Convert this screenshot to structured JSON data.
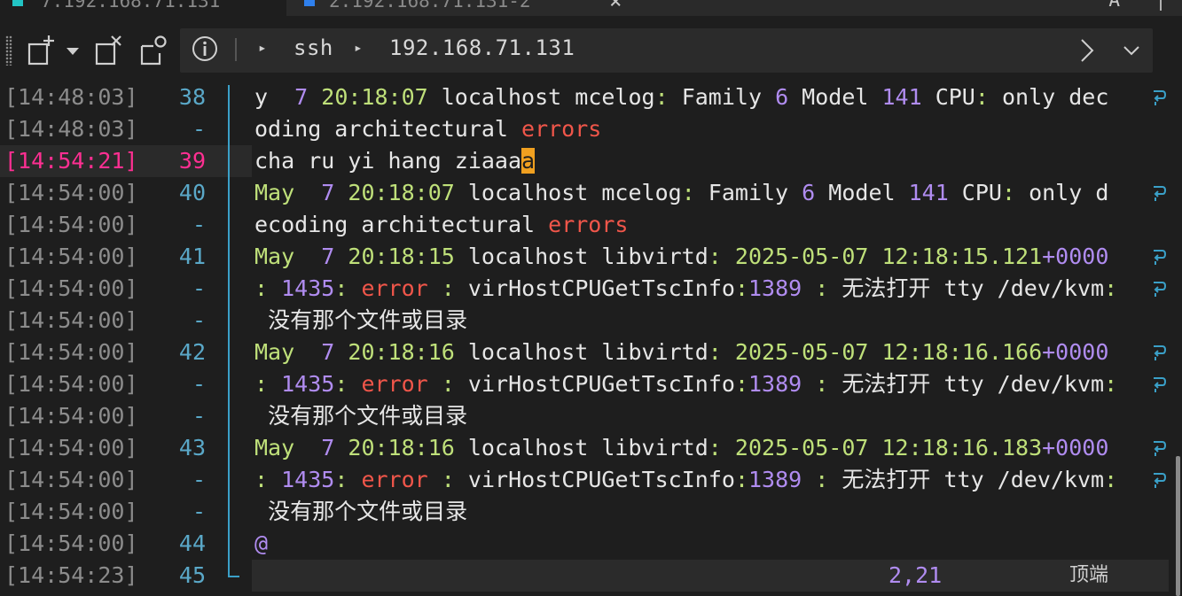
{
  "tabs": [
    {
      "label": "7.192.168.71.131",
      "active": true,
      "color": "#22c4c4"
    },
    {
      "label": "2.192.168.71.131-2",
      "active": false,
      "color": "#2f80ed"
    }
  ],
  "window_controls": {
    "a_label": "A",
    "close_label": "×"
  },
  "toolbar": {
    "icons": [
      "new-tab-icon",
      "dropdown-icon",
      "detach-tab-icon",
      "session-settings-icon"
    ]
  },
  "breadcrumb": {
    "arrow": "▸",
    "items": [
      "ssh",
      "192.168.71.131"
    ]
  },
  "gutter": [
    {
      "time": "[14:48:03]",
      "line": "38"
    },
    {
      "time": "[14:48:03]",
      "line": "-"
    },
    {
      "time": "[14:54:21]",
      "line": "39",
      "active": true
    },
    {
      "time": "[14:54:00]",
      "line": "40"
    },
    {
      "time": "[14:54:00]",
      "line": "-"
    },
    {
      "time": "[14:54:00]",
      "line": "41"
    },
    {
      "time": "[14:54:00]",
      "line": "-"
    },
    {
      "time": "[14:54:00]",
      "line": "-"
    },
    {
      "time": "[14:54:00]",
      "line": "42"
    },
    {
      "time": "[14:54:00]",
      "line": "-"
    },
    {
      "time": "[14:54:00]",
      "line": "-"
    },
    {
      "time": "[14:54:00]",
      "line": "43"
    },
    {
      "time": "[14:54:00]",
      "line": "-"
    },
    {
      "time": "[14:54:00]",
      "line": "-"
    },
    {
      "time": "[14:54:00]",
      "line": "44"
    },
    {
      "time": "[14:54:23]",
      "line": "45"
    }
  ],
  "lines": [
    {
      "wrap": true,
      "segs": [
        [
          "y  ",
          "white"
        ],
        [
          "7",
          "purple"
        ],
        [
          " ",
          "white"
        ],
        [
          "20:18:07",
          "green"
        ],
        [
          " localhost mcelog",
          "white"
        ],
        [
          ":",
          "green"
        ],
        [
          " Family ",
          "white"
        ],
        [
          "6",
          "purple"
        ],
        [
          " Model ",
          "white"
        ],
        [
          "141",
          "purple"
        ],
        [
          " CPU",
          "white"
        ],
        [
          ":",
          "green"
        ],
        [
          " only dec",
          "white"
        ]
      ]
    },
    {
      "wrap": false,
      "segs": [
        [
          "oding architectural ",
          "white"
        ],
        [
          "errors",
          "red"
        ]
      ]
    },
    {
      "wrap": false,
      "segs": [
        [
          "cha ru yi hang ziaaa",
          "white"
        ],
        [
          "a",
          "cursor"
        ]
      ]
    },
    {
      "wrap": true,
      "segs": [
        [
          "May",
          "green"
        ],
        [
          "  ",
          "white"
        ],
        [
          "7",
          "purple"
        ],
        [
          " ",
          "white"
        ],
        [
          "20:18:07",
          "green"
        ],
        [
          " localhost mcelog",
          "white"
        ],
        [
          ":",
          "green"
        ],
        [
          " Family ",
          "white"
        ],
        [
          "6",
          "purple"
        ],
        [
          " Model ",
          "white"
        ],
        [
          "141",
          "purple"
        ],
        [
          " CPU",
          "white"
        ],
        [
          ":",
          "green"
        ],
        [
          " only d",
          "white"
        ]
      ]
    },
    {
      "wrap": false,
      "segs": [
        [
          "ecoding architectural ",
          "white"
        ],
        [
          "errors",
          "red"
        ]
      ]
    },
    {
      "wrap": true,
      "segs": [
        [
          "May",
          "green"
        ],
        [
          "  ",
          "white"
        ],
        [
          "7",
          "purple"
        ],
        [
          " ",
          "white"
        ],
        [
          "20:18:15",
          "green"
        ],
        [
          " localhost libvirtd",
          "white"
        ],
        [
          ":",
          "green"
        ],
        [
          " ",
          "white"
        ],
        [
          "2025-05-07",
          "green"
        ],
        [
          " ",
          "white"
        ],
        [
          "12:18:15.121",
          "green"
        ],
        [
          "+0000",
          "purple"
        ]
      ]
    },
    {
      "wrap": true,
      "segs": [
        [
          ":",
          "green"
        ],
        [
          " ",
          "white"
        ],
        [
          "1435",
          "purple"
        ],
        [
          ":",
          "green"
        ],
        [
          " ",
          "white"
        ],
        [
          "error",
          "red"
        ],
        [
          " ",
          "white"
        ],
        [
          ":",
          "green"
        ],
        [
          " virHostCPUGetTscInfo",
          "white"
        ],
        [
          ":",
          "green"
        ],
        [
          "1389",
          "purple"
        ],
        [
          " ",
          "white"
        ],
        [
          ":",
          "green"
        ],
        [
          " ",
          "white"
        ],
        [
          "无法打开",
          "cjk"
        ],
        [
          " tty /dev/kvm",
          "white"
        ],
        [
          ":",
          "green"
        ]
      ]
    },
    {
      "wrap": false,
      "segs": [
        [
          " ",
          "white"
        ],
        [
          "没有那个文件或目录",
          "cjk"
        ]
      ]
    },
    {
      "wrap": true,
      "segs": [
        [
          "May",
          "green"
        ],
        [
          "  ",
          "white"
        ],
        [
          "7",
          "purple"
        ],
        [
          " ",
          "white"
        ],
        [
          "20:18:16",
          "green"
        ],
        [
          " localhost libvirtd",
          "white"
        ],
        [
          ":",
          "green"
        ],
        [
          " ",
          "white"
        ],
        [
          "2025-05-07",
          "green"
        ],
        [
          " ",
          "white"
        ],
        [
          "12:18:16.166",
          "green"
        ],
        [
          "+0000",
          "purple"
        ]
      ]
    },
    {
      "wrap": true,
      "segs": [
        [
          ":",
          "green"
        ],
        [
          " ",
          "white"
        ],
        [
          "1435",
          "purple"
        ],
        [
          ":",
          "green"
        ],
        [
          " ",
          "white"
        ],
        [
          "error",
          "red"
        ],
        [
          " ",
          "white"
        ],
        [
          ":",
          "green"
        ],
        [
          " virHostCPUGetTscInfo",
          "white"
        ],
        [
          ":",
          "green"
        ],
        [
          "1389",
          "purple"
        ],
        [
          " ",
          "white"
        ],
        [
          ":",
          "green"
        ],
        [
          " ",
          "white"
        ],
        [
          "无法打开",
          "cjk"
        ],
        [
          " tty /dev/kvm",
          "white"
        ],
        [
          ":",
          "green"
        ]
      ]
    },
    {
      "wrap": false,
      "segs": [
        [
          " ",
          "white"
        ],
        [
          "没有那个文件或目录",
          "cjk"
        ]
      ]
    },
    {
      "wrap": true,
      "segs": [
        [
          "May",
          "green"
        ],
        [
          "  ",
          "white"
        ],
        [
          "7",
          "purple"
        ],
        [
          " ",
          "white"
        ],
        [
          "20:18:16",
          "green"
        ],
        [
          " localhost libvirtd",
          "white"
        ],
        [
          ":",
          "green"
        ],
        [
          " ",
          "white"
        ],
        [
          "2025-05-07",
          "green"
        ],
        [
          " ",
          "white"
        ],
        [
          "12:18:16.183",
          "green"
        ],
        [
          "+0000",
          "purple"
        ]
      ]
    },
    {
      "wrap": true,
      "segs": [
        [
          ":",
          "green"
        ],
        [
          " ",
          "white"
        ],
        [
          "1435",
          "purple"
        ],
        [
          ":",
          "green"
        ],
        [
          " ",
          "white"
        ],
        [
          "error",
          "red"
        ],
        [
          " ",
          "white"
        ],
        [
          ":",
          "green"
        ],
        [
          " virHostCPUGetTscInfo",
          "white"
        ],
        [
          ":",
          "green"
        ],
        [
          "1389",
          "purple"
        ],
        [
          " ",
          "white"
        ],
        [
          ":",
          "green"
        ],
        [
          " ",
          "white"
        ],
        [
          "无法打开",
          "cjk"
        ],
        [
          " tty /dev/kvm",
          "white"
        ],
        [
          ":",
          "green"
        ]
      ]
    },
    {
      "wrap": false,
      "segs": [
        [
          " ",
          "white"
        ],
        [
          "没有那个文件或目录",
          "cjk"
        ]
      ]
    },
    {
      "wrap": false,
      "segs": [
        [
          "@",
          "purple"
        ]
      ]
    }
  ],
  "status": {
    "position": "2,21",
    "scroll": "顶端"
  },
  "colors": {
    "background": "#1e1e1e",
    "green": "#bfe07a",
    "purple": "#b08cf0",
    "red": "#f0564a",
    "cursor": "#f0a020",
    "active_time": "#ff2f92",
    "gutter_bar": "#3aa0c8"
  }
}
